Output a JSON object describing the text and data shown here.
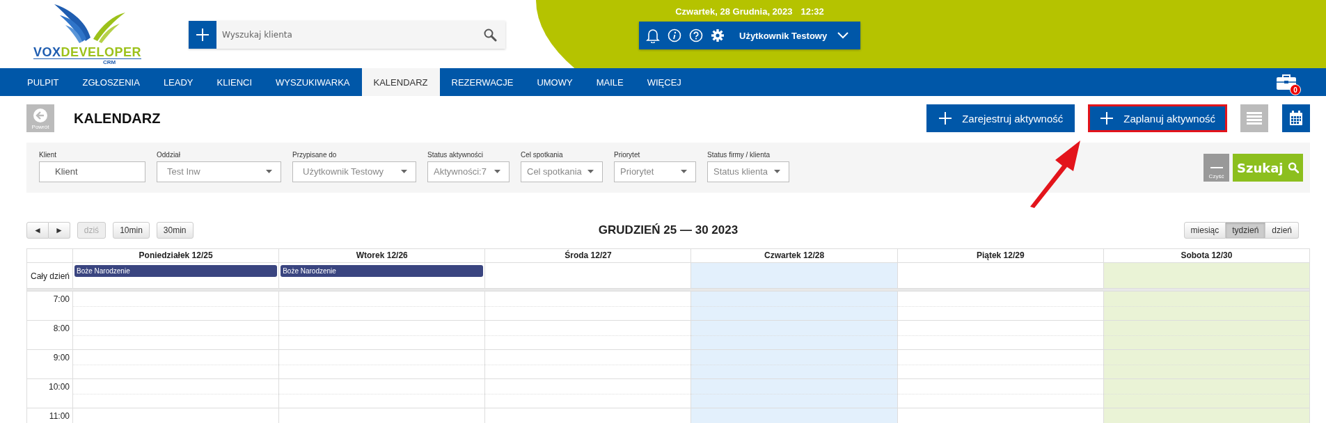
{
  "logo": {
    "part_1": "VOX",
    "part_2": "DEVELOPER",
    "sub": "CRM"
  },
  "search": {
    "placeholder": "Wyszukaj klienta"
  },
  "datetime": {
    "date": "Czwartek, 28 Grudnia, 2023",
    "time": "12:32"
  },
  "user": {
    "name": "Użytkownik Testowy"
  },
  "nav": [
    {
      "label": "PULPIT",
      "selected": false
    },
    {
      "label": "ZGŁOSZENIA",
      "selected": false
    },
    {
      "label": "LEADY",
      "selected": false
    },
    {
      "label": "KLIENCI",
      "selected": false
    },
    {
      "label": "WYSZUKIWARKA",
      "selected": false
    },
    {
      "label": "KALENDARZ",
      "selected": true
    },
    {
      "label": "REZERWACJE",
      "selected": false
    },
    {
      "label": "UMOWY",
      "selected": false
    },
    {
      "label": "MAILE",
      "selected": false
    },
    {
      "label": "WIĘCEJ",
      "selected": false
    }
  ],
  "cart_badge": "0",
  "page": {
    "back_label": "Powrót",
    "title": "KALENDARZ"
  },
  "actions": [
    {
      "label": "Zarejestruj aktywność",
      "highlighted": false
    },
    {
      "label": "Zaplanuj aktywność",
      "highlighted": true
    }
  ],
  "view_toggles": [
    {
      "kind": "list",
      "selected": false
    },
    {
      "kind": "calendar",
      "selected": true
    }
  ],
  "filters": [
    {
      "label": "Klient",
      "kind": "text",
      "placeholder": "Klient"
    },
    {
      "label": "Oddział",
      "kind": "select",
      "value": "Test Inw"
    },
    {
      "label": "Przypisane do",
      "kind": "select",
      "value": "Użytkownik Testowy"
    },
    {
      "label": "Status aktywności",
      "kind": "select",
      "value": "Aktywności:7"
    },
    {
      "label": "Cel spotkania",
      "kind": "select",
      "value": "Cel spotkania"
    },
    {
      "label": "Priorytet",
      "kind": "select",
      "value": "Priorytet"
    },
    {
      "label": "Status firmy / klienta",
      "kind": "select",
      "value": "Status klienta"
    }
  ],
  "clear_label": "Czyść",
  "search_button": "Szukaj",
  "calendar": {
    "prev": "◄",
    "next": "►",
    "buttons": [
      {
        "label": "dziś",
        "disabled": true
      },
      {
        "label": "10min",
        "disabled": false
      },
      {
        "label": "30min",
        "disabled": false
      }
    ],
    "title": "GRUDZIEŃ 25 — 30 2023",
    "views": [
      {
        "label": "miesiąc",
        "selected": false
      },
      {
        "label": "tydzień",
        "selected": true
      },
      {
        "label": "dzień",
        "selected": false
      }
    ],
    "allday_label": "Cały dzień",
    "days": [
      {
        "label": "Poniedziałek 12/25",
        "today": false,
        "weekend": false,
        "events": [
          "Boże Narodzenie"
        ]
      },
      {
        "label": "Wtorek 12/26",
        "today": false,
        "weekend": false,
        "events": [
          "Boże Narodzenie"
        ]
      },
      {
        "label": "Środa 12/27",
        "today": false,
        "weekend": false
      },
      {
        "label": "Czwartek 12/28",
        "today": true,
        "weekend": false
      },
      {
        "label": "Piątek 12/29",
        "today": false,
        "weekend": false
      },
      {
        "label": "Sobota 12/30",
        "today": false,
        "weekend": true
      }
    ],
    "hours": [
      "7:00",
      "8:00",
      "9:00",
      "10:00",
      "11:00"
    ]
  }
}
